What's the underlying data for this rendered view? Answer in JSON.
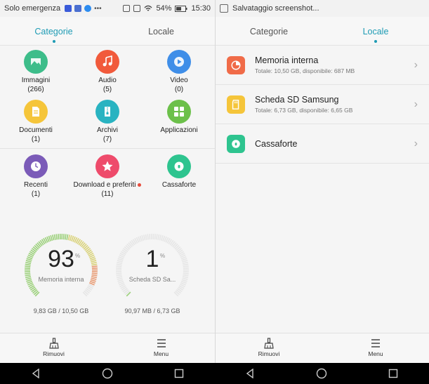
{
  "status_left": {
    "carrier": "Solo emergenza",
    "battery": "54%",
    "time": "15:30"
  },
  "status_right": {
    "notification": "Salvataggio screenshot..."
  },
  "tabs": {
    "categories": "Categorie",
    "local": "Locale"
  },
  "categories": [
    {
      "label": "Immagini",
      "count": "(266)",
      "color": "#3dbd8a",
      "icon": "image-icon"
    },
    {
      "label": "Audio",
      "count": "(5)",
      "color": "#f15a3b",
      "icon": "music-icon"
    },
    {
      "label": "Video",
      "count": "(0)",
      "color": "#3f8ee8",
      "icon": "play-icon"
    },
    {
      "label": "Documenti",
      "count": "(1)",
      "color": "#f5c53a",
      "icon": "document-icon"
    },
    {
      "label": "Archivi",
      "count": "(7)",
      "color": "#29b3c1",
      "icon": "archive-icon"
    },
    {
      "label": "Applicazioni",
      "count": "",
      "color": "#6cc04a",
      "icon": "apps-icon"
    },
    {
      "label": "Recenti",
      "count": "(1)",
      "color": "#7b5bb8",
      "icon": "clock-icon"
    },
    {
      "label": "Download e preferiti",
      "count": "(11)",
      "color": "#ee4b6b",
      "icon": "star-icon"
    },
    {
      "label": "Cassaforte",
      "count": "",
      "color": "#2ec48f",
      "icon": "safe-icon"
    }
  ],
  "gauges": [
    {
      "value": "93",
      "unit": "%",
      "label": "Memoria interna",
      "detail": "9,83 GB / 10,50 GB",
      "fraction": 0.93
    },
    {
      "value": "1",
      "unit": "%",
      "label": "Scheda SD Sa...",
      "detail": "90,97 MB / 6,73 GB",
      "fraction": 0.01
    }
  ],
  "storage": [
    {
      "name": "Memoria interna",
      "detail": "Totale: 10,50 GB, disponibile: 687 MB",
      "color": "#f06b48",
      "icon": "pie-icon"
    },
    {
      "name": "Scheda SD Samsung",
      "detail": "Totale: 6,73 GB, disponibile: 6,65 GB",
      "color": "#f5c53a",
      "icon": "sdcard-icon"
    },
    {
      "name": "Cassaforte",
      "detail": "",
      "color": "#2ec48f",
      "icon": "safe-icon"
    }
  ],
  "bottom": {
    "remove": "Rimuovi",
    "menu": "Menu"
  }
}
